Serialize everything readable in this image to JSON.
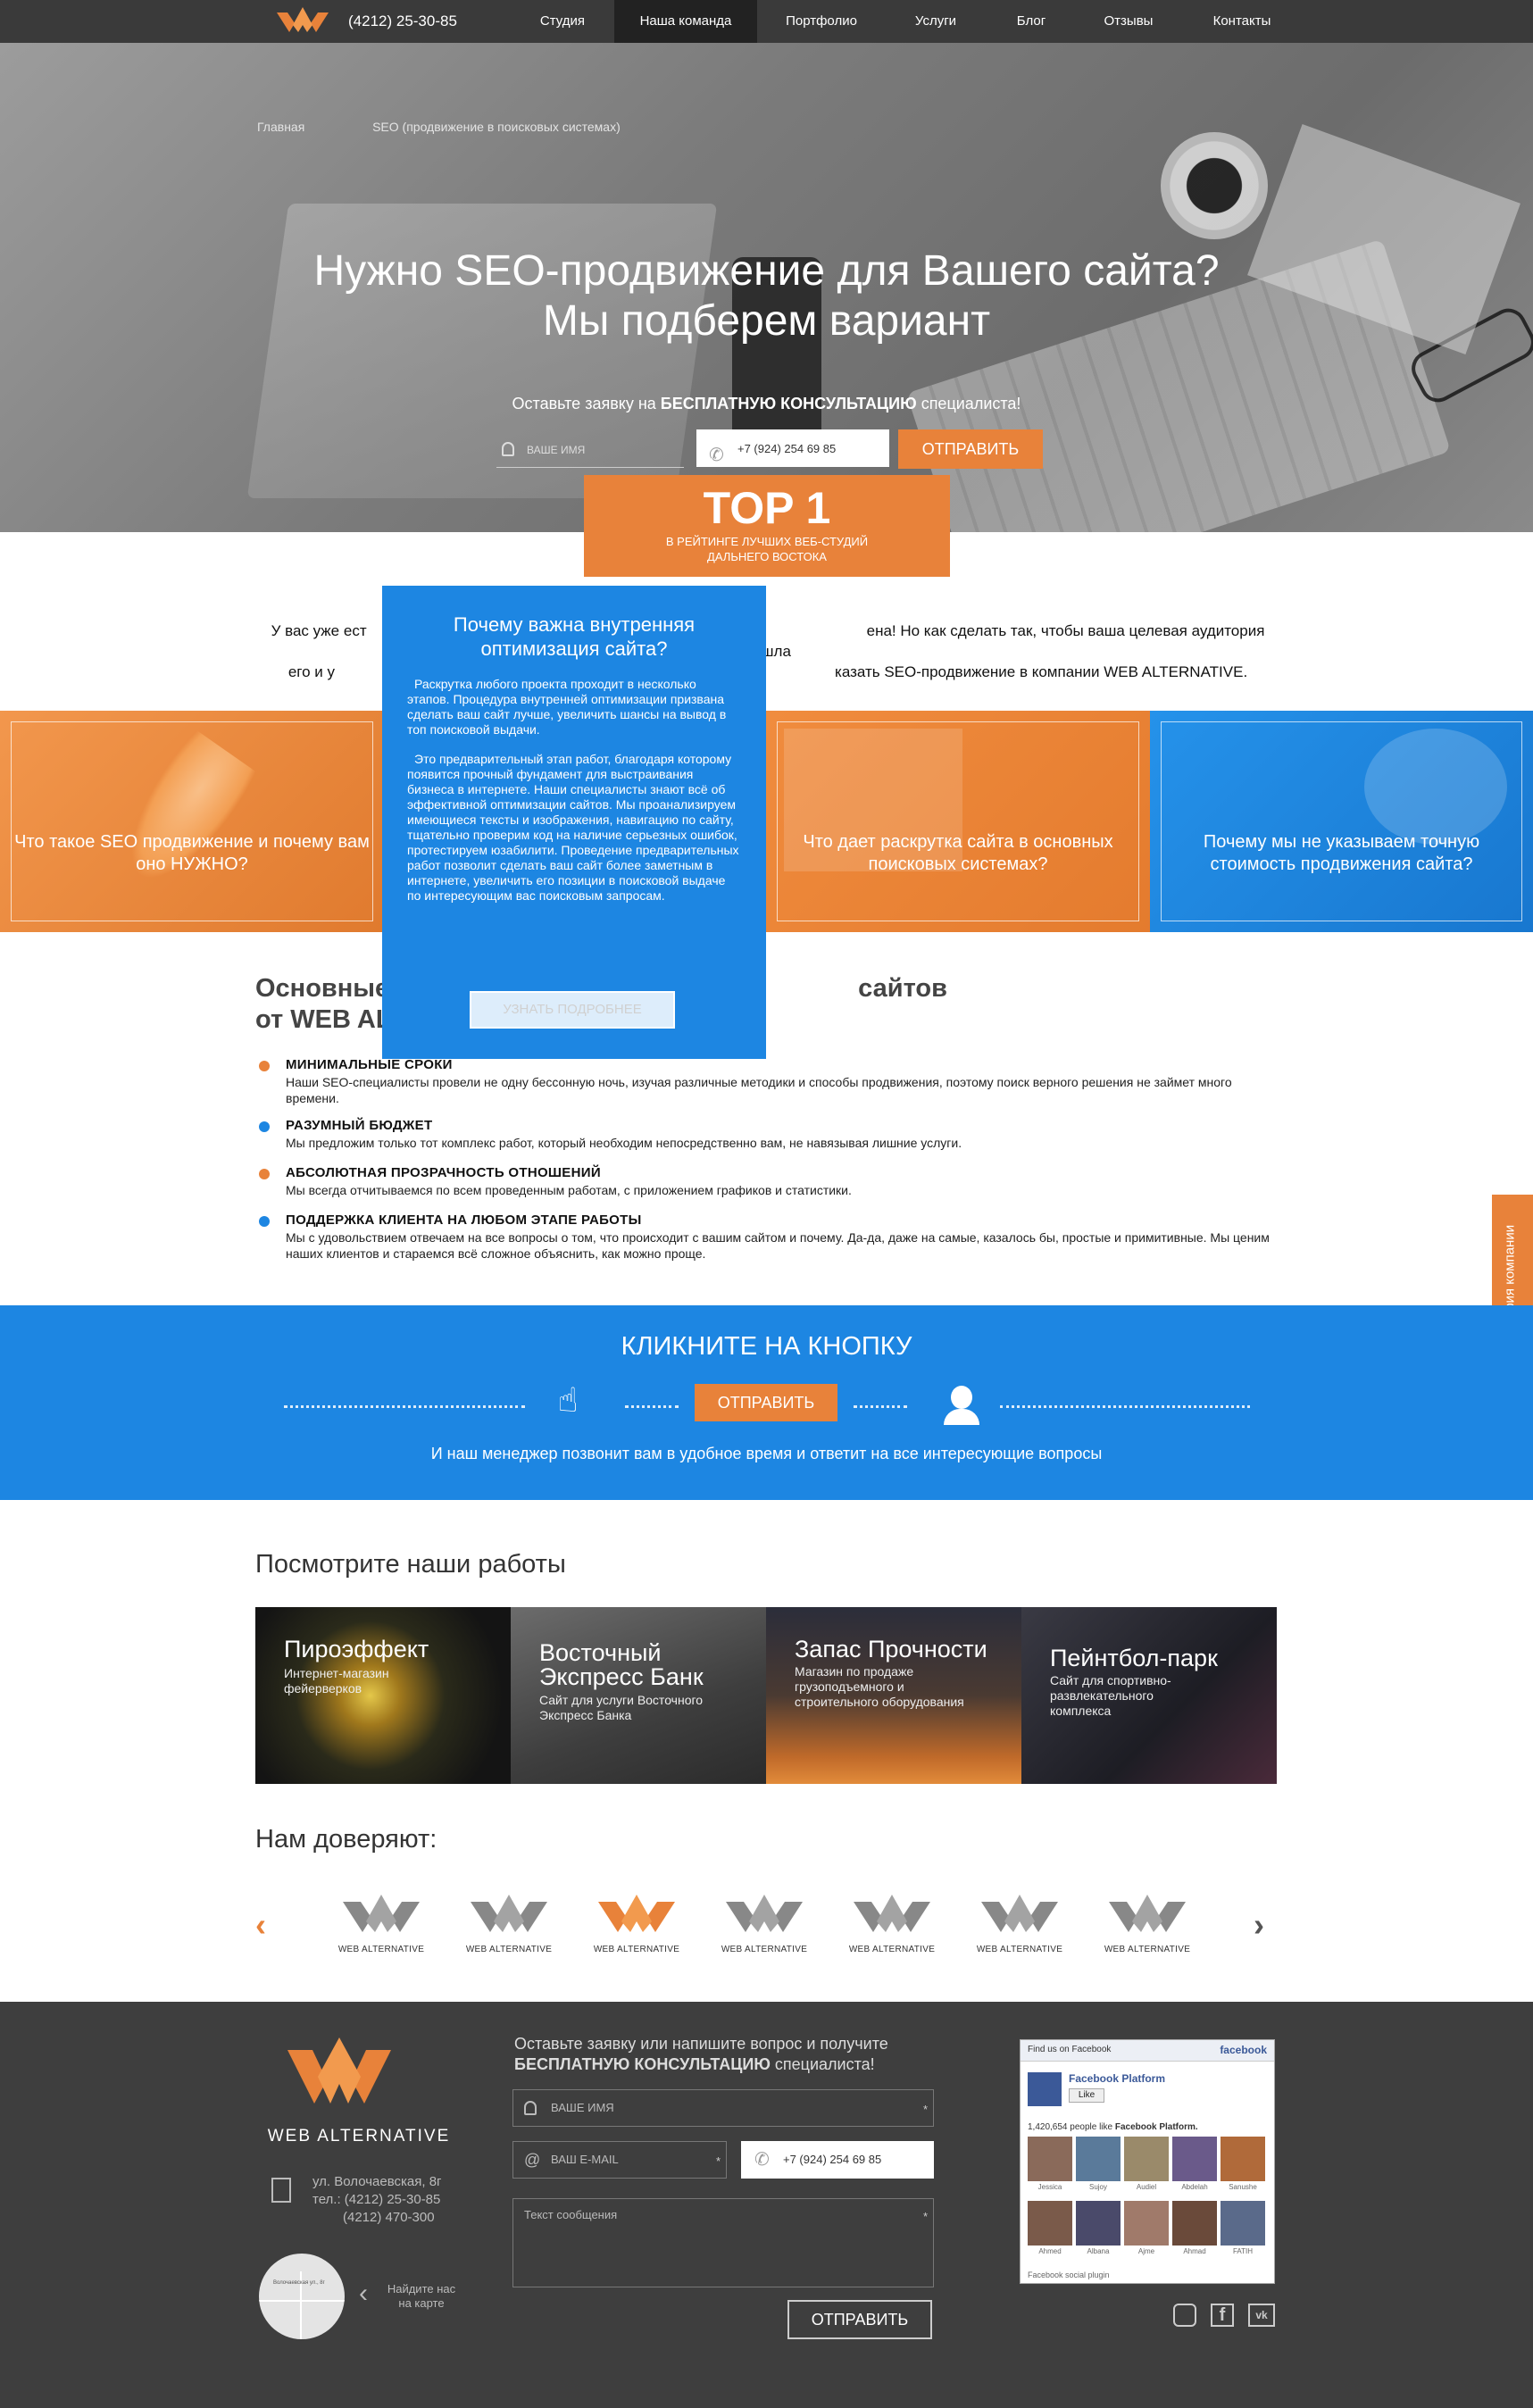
{
  "colors": {
    "orange": "#e8823a",
    "blue": "#1d86e2",
    "dark": "#3a3a3a"
  },
  "nav": {
    "phone": "(4212) 25-30-85",
    "items": [
      "Студия",
      "Наша команда",
      "Портфолио",
      "Услуги",
      "Блог",
      "Отзывы",
      "Контакты"
    ],
    "active": "Наша команда"
  },
  "hero": {
    "breadcrumb": {
      "home": "Главная",
      "current": "SEO (продвижение в поисковых системах)"
    },
    "title_line1": "Нужно SEO-продвижение для Вашего сайта?",
    "title_line2": "Мы подберем вариант",
    "lead_before": "Оставьте заявку на ",
    "lead_bold": "БЕСПЛАТНУЮ КОНСУЛЬТАЦИЮ",
    "lead_after": " специалиста!",
    "name_placeholder": "ВАШЕ ИМЯ",
    "phone_value": "+7 (924) 254 69 85",
    "submit": "ОТПРАВИТЬ"
  },
  "top1": {
    "big": "TOP 1",
    "line1": "В РЕЙТИНГЕ ЛУЧШИХ ВЕБ-СТУДИЙ",
    "line2": "ДАЛЬНЕГО ВОСТОКА"
  },
  "intro": {
    "line1a": "У вас уже ест",
    "line1b": "ена! Но как сделать так, чтобы ваша целевая аудитория нашла",
    "line2a": "его и у",
    "line2b": "казать SEO-продвижение в компании WEB ALTERNATIVE."
  },
  "popup": {
    "title": "Почему важна внутренняя оптимизация сайта?",
    "p1": "Раскрутка любого проекта проходит в несколько этапов. Процедура внутренней оптимизации призвана сделать ваш сайт лучше, увеличить шансы на вывод в топ поисковой выдачи.",
    "p2": "Это предварительный этап работ, благодаря которому появится прочный фундамент для выстраивания бизнеса в интернете. Наши специалисты знают всё об эффективной оптимизации сайтов. Мы проанализируем имеющиеся тексты и изображения, навигацию по сайту, тщательно проверим код на наличие серьезных ошибок, протестируем юзабилити. Проведение предварительных работ позволит сделать ваш сайт более заметным в интернете, увеличить его позиции в поисковой выдаче по интересующим вас поисковым запросам.",
    "button": "УЗНАТЬ ПОДРОБНЕЕ"
  },
  "tiles": [
    {
      "text": "Что такое SEO продвижение и почему вам оно НУЖНО?"
    },
    {
      "text": ""
    },
    {
      "text": "Что дает раскрутка сайта в основных поисковых системах?"
    },
    {
      "text": "Почему мы не указываем точную стоимость продвижения сайта?"
    }
  ],
  "advantages": {
    "title_line1a": "Основные",
    "title_line1b": "сайтов",
    "title_line2": "от WEB AL",
    "items": [
      {
        "title": "МИНИМАЛЬНЫЕ СРОКИ",
        "text": "Наши SEO-специалисты провели не одну бессонную ночь, изучая различные методики и способы продвижения, поэтому поиск верного решения не займет много времени."
      },
      {
        "title": "РАЗУМНЫЙ БЮДЖЕТ",
        "text": "Мы предложим только тот комплекс работ, который необходим непосредственно вам, не навязывая лишние услуги."
      },
      {
        "title": "АБСОЛЮТНАЯ ПРОЗРАЧНОСТЬ ОТНОШЕНИЙ",
        "text": "Мы всегда отчитываемся по всем проведенным работам, с приложением графиков и статистики."
      },
      {
        "title": "ПОДДЕРЖКА КЛИЕНТА НА ЛЮБОМ ЭТАПЕ РАБОТЫ",
        "text": "Мы с удовольствием отвечаем на все вопросы о том, что происходит с вашим сайтом и почему. Да-да, даже на самые, казалось бы, простые и примитивные. Мы ценим наших клиентов и стараемся всё сложное объяснить, как можно проще."
      }
    ]
  },
  "side_tab": "История компании",
  "cta": {
    "title": "КЛИКНИТЕ НА КНОПКУ",
    "button": "ОТПРАВИТЬ",
    "sub": "И наш менеджер позвонит вам в удобное время и ответит на все интересующие вопросы"
  },
  "works": {
    "title": "Посмотрите наши работы",
    "items": [
      {
        "title": "Пироэффект",
        "desc": "Интернет-магазин фейерверков"
      },
      {
        "title": "Восточный Экспресс Банк",
        "desc": "Сайт для услуги Восточного Экспресс Банка"
      },
      {
        "title": "Запас Прочности",
        "desc": "Магазин по продаже грузоподъемного и строительного оборудования"
      },
      {
        "title": "Пейнтбол-парк",
        "desc": "Сайт для спортивно-развлекательного комплекса"
      }
    ]
  },
  "trust": {
    "title": "Нам доверяют:",
    "logo_text": "WEB ALTERNATIVE",
    "count": 7
  },
  "footer": {
    "brand": "WEB ALTERNATIVE",
    "address": "ул. Волочаевская, 8г",
    "tel1": "тел.: (4212) 25-30-85",
    "tel2": "(4212) 470-300",
    "map_label": "Волочаевская ул., 8г",
    "map_link": "Найдите нас на карте",
    "form_lead1": "Оставьте заявку или напишите вопрос и получите",
    "form_lead_bold": "БЕСПЛАТНУЮ КОНСУЛЬТАЦИЮ",
    "form_lead_after": " специалиста!",
    "name_placeholder": "ВАШЕ ИМЯ",
    "email_placeholder": "ВАШ E-MAIL",
    "phone_value": "+7 (924) 254 69 85",
    "message_placeholder": "Текст сообщения",
    "submit": "ОТПРАВИТЬ",
    "fb": {
      "find": "Find us on Facebook",
      "brand": "facebook",
      "page": "Facebook Platform",
      "like": "Like",
      "count_text": "1,420,654 people like",
      "count_page": "Facebook Platform.",
      "names": [
        "Jessica",
        "Sujoy",
        "Audiel",
        "Abdelah",
        "Sanushe",
        "Ahmed",
        "Albana",
        "Ajme",
        "Ahmad",
        "FATIH"
      ],
      "plugin": "Facebook social plugin"
    },
    "social": [
      "instagram",
      "facebook",
      "vk"
    ]
  }
}
